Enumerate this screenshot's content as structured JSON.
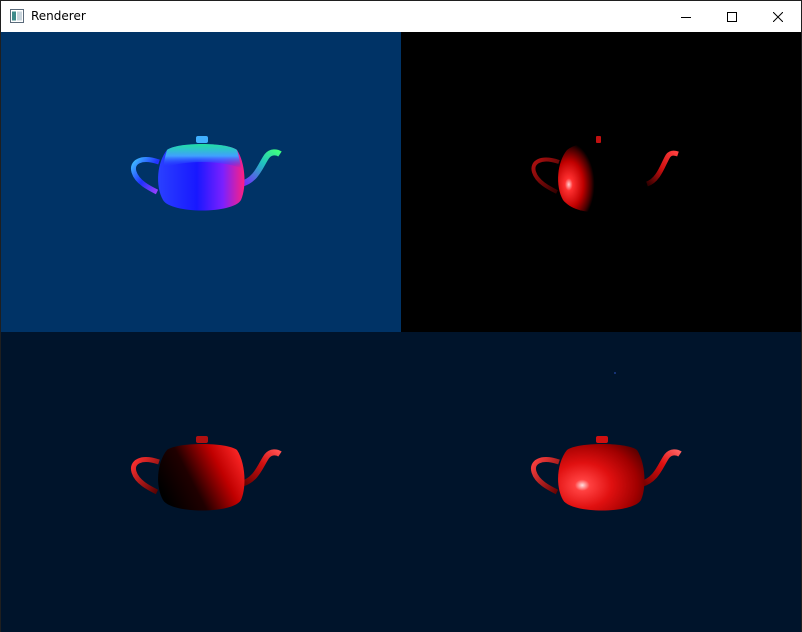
{
  "window": {
    "title": "Renderer",
    "app_icon": "app-window-icon",
    "controls": {
      "minimize_icon": "minimize-icon",
      "maximize_icon": "maximize-icon",
      "close_icon": "close-icon"
    }
  },
  "viewports": [
    {
      "position": "top-left",
      "background": "#003366",
      "shading": "normal-map",
      "teapot_icon": "teapot-icon"
    },
    {
      "position": "top-right",
      "background": "#000000",
      "shading": "red-lit-partial",
      "teapot_icon": "teapot-icon"
    },
    {
      "position": "bottom-left",
      "background": "#00142b",
      "shading": "red-diffuse",
      "teapot_icon": "teapot-icon"
    },
    {
      "position": "bottom-right",
      "background": "#00142b",
      "shading": "red-phong",
      "teapot_icon": "teapot-icon"
    }
  ],
  "colors": {
    "titlebar": "#ffffff",
    "teapot_red": "#e01010",
    "normal_blue": "#1a1aff",
    "normal_magenta": "#e020c0",
    "normal_cyan": "#20d0c0"
  }
}
